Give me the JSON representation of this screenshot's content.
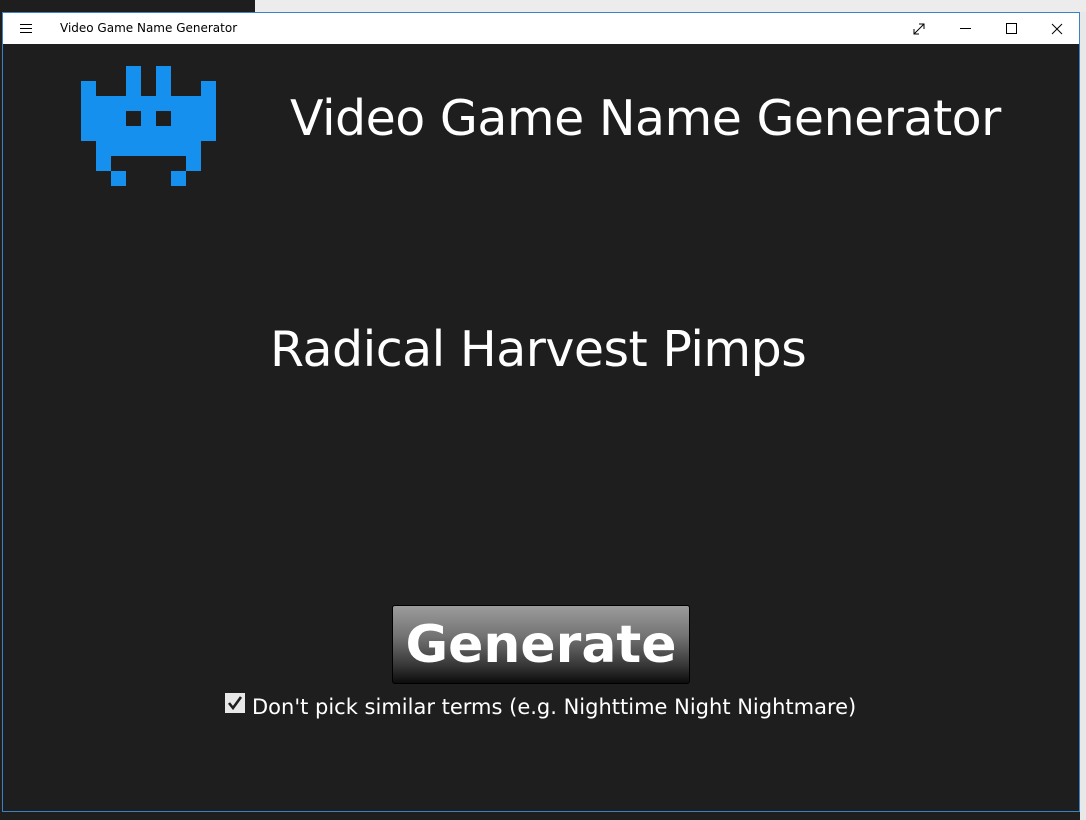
{
  "window": {
    "title": "Video Game Name Generator"
  },
  "titlebar": {
    "icons": [
      "hamburger-icon",
      "fullscreen-icon",
      "minimize-icon",
      "maximize-icon",
      "close-icon"
    ]
  },
  "main": {
    "heading": "Video Game Name Generator",
    "generated_name": "Radical Harvest Pimps",
    "generate_label": "Generate",
    "checkbox_label": "Don't pick similar terms (e.g. Nighttime Night Nightmare)",
    "checkbox_checked": true,
    "logo_icon": "space-invader-icon"
  },
  "colors": {
    "background": "#1e1e1e",
    "accent": "#1590ef",
    "text": "#ffffff"
  }
}
